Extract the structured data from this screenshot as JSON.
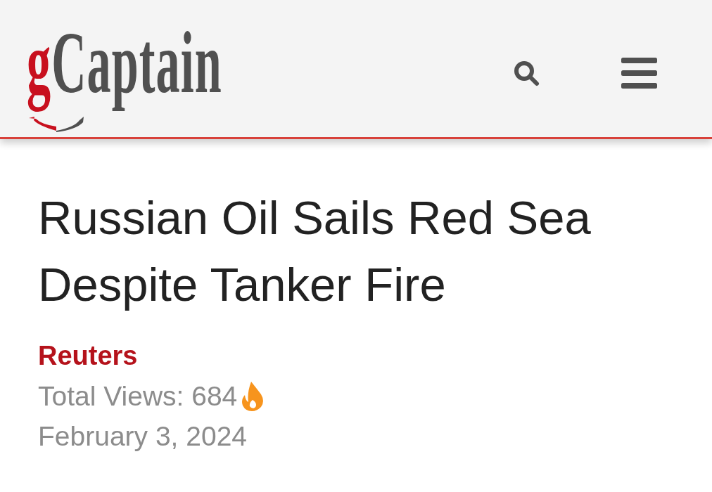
{
  "header": {
    "logo": {
      "accent": "g",
      "name": "Captain"
    }
  },
  "article": {
    "title": "Russian Oil Sails Red Sea Despite Tanker Fire",
    "source": "Reuters",
    "views": "Total Views: 684",
    "date": "February 3, 2024"
  }
}
